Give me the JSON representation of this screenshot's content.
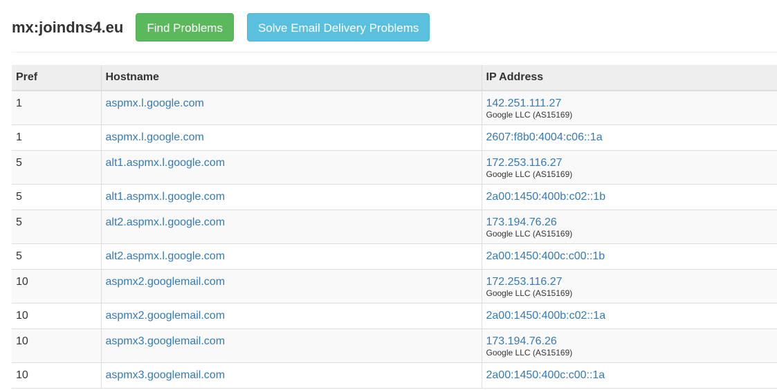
{
  "header": {
    "title": "mx:joindns4.eu",
    "find_problems_label": "Find Problems",
    "solve_email_label": "Solve Email Delivery Problems"
  },
  "colors": {
    "success": "#5cb85c",
    "info": "#5bc0de",
    "link": "#337ab7",
    "header_bg": "#eeeeee",
    "stripe_bg": "#f9f9f9"
  },
  "table": {
    "columns": [
      "Pref",
      "Hostname",
      "IP Address"
    ],
    "rows": [
      {
        "pref": "1",
        "hostname": "aspmx.l.google.com",
        "ip": "142.251.111.27",
        "asn": "Google LLC (AS15169)"
      },
      {
        "pref": "1",
        "hostname": "aspmx.l.google.com",
        "ip": "2607:f8b0:4004:c06::1a",
        "asn": ""
      },
      {
        "pref": "5",
        "hostname": "alt1.aspmx.l.google.com",
        "ip": "172.253.116.27",
        "asn": "Google LLC (AS15169)"
      },
      {
        "pref": "5",
        "hostname": "alt1.aspmx.l.google.com",
        "ip": "2a00:1450:400b:c02::1b",
        "asn": ""
      },
      {
        "pref": "5",
        "hostname": "alt2.aspmx.l.google.com",
        "ip": "173.194.76.26",
        "asn": "Google LLC (AS15169)"
      },
      {
        "pref": "5",
        "hostname": "alt2.aspmx.l.google.com",
        "ip": "2a00:1450:400c:c00::1b",
        "asn": ""
      },
      {
        "pref": "10",
        "hostname": "aspmx2.googlemail.com",
        "ip": "172.253.116.27",
        "asn": "Google LLC (AS15169)"
      },
      {
        "pref": "10",
        "hostname": "aspmx2.googlemail.com",
        "ip": "2a00:1450:400b:c02::1a",
        "asn": ""
      },
      {
        "pref": "10",
        "hostname": "aspmx3.googlemail.com",
        "ip": "173.194.76.26",
        "asn": "Google LLC (AS15169)"
      },
      {
        "pref": "10",
        "hostname": "aspmx3.googlemail.com",
        "ip": "2a00:1450:400c:c00::1a",
        "asn": ""
      }
    ]
  }
}
